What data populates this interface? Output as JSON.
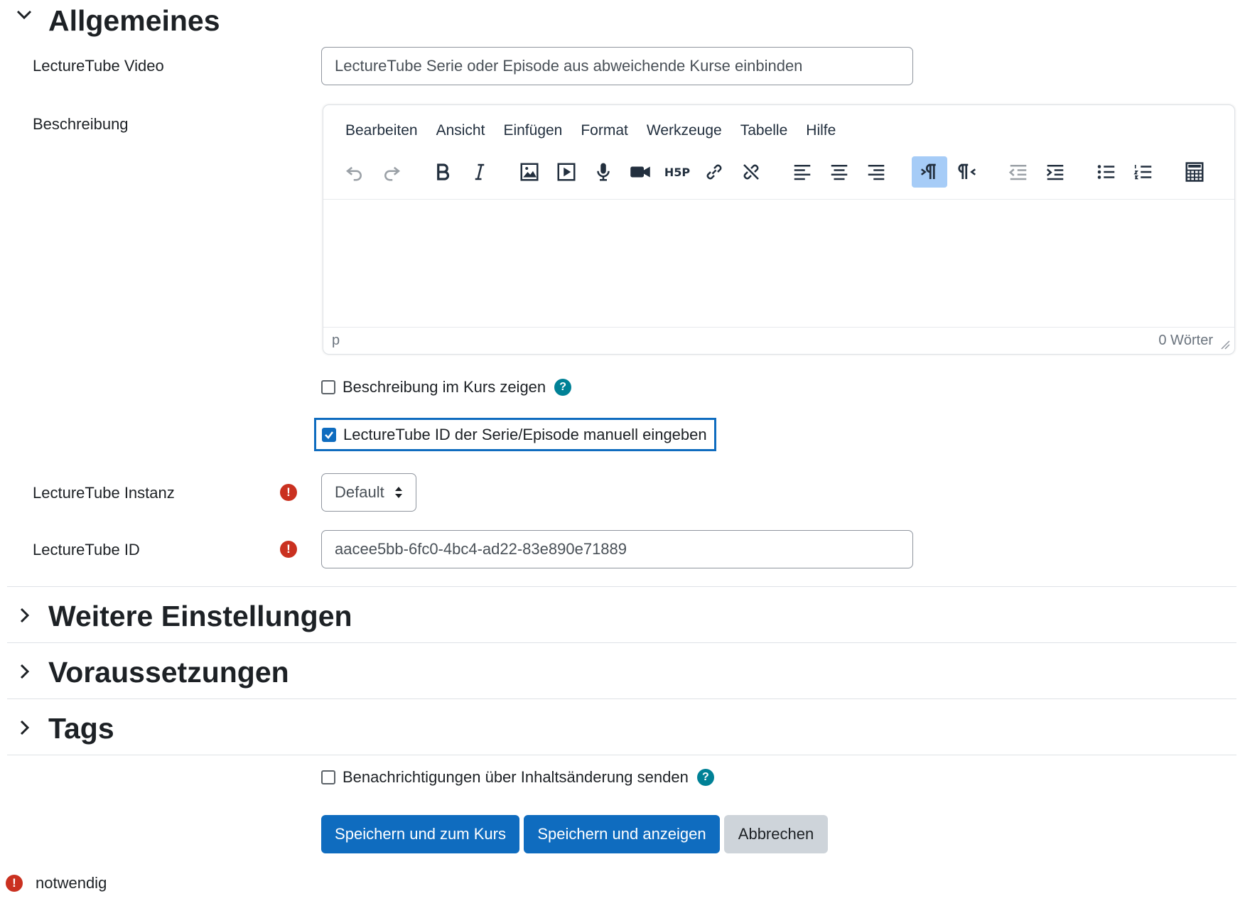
{
  "sections": {
    "general": "Allgemeines",
    "more_settings": "Weitere Einstellungen",
    "prerequisites": "Voraussetzungen",
    "tags": "Tags"
  },
  "fields": {
    "video_label": "LectureTube Video",
    "video_value": "LectureTube Serie oder Episode aus abweichende Kurse einbinden",
    "description_label": "Beschreibung",
    "instance_label": "LectureTube Instanz",
    "instance_value": "Default",
    "id_label": "LectureTube ID",
    "id_value": "aacee5bb-6fc0-4bc4-ad22-83e890e71889"
  },
  "editor": {
    "menu": [
      "Bearbeiten",
      "Ansicht",
      "Einfügen",
      "Format",
      "Werkzeuge",
      "Tabelle",
      "Hilfe"
    ],
    "status_path": "p",
    "word_count": "0 Wörter",
    "toolbar_icons": [
      "undo-icon",
      "redo-icon",
      "bold-icon",
      "italic-icon",
      "image-icon",
      "media-icon",
      "microphone-icon",
      "video-camera-icon",
      "h5p-icon",
      "link-icon",
      "unlink-icon",
      "align-left-icon",
      "align-center-icon",
      "align-right-icon",
      "ltr-icon",
      "rtl-icon",
      "outdent-icon",
      "indent-icon",
      "bullet-list-icon",
      "numbered-list-icon",
      "calculator-icon"
    ],
    "h5p_text": "H5P"
  },
  "checkboxes": {
    "show_description": "Beschreibung im Kurs zeigen",
    "show_description_checked": false,
    "manual_id": "LectureTube ID der Serie/Episode manuell eingeben",
    "manual_id_checked": true,
    "notify": "Benachrichtigungen über Inhaltsänderung senden",
    "notify_checked": false
  },
  "buttons": {
    "save_return": "Speichern und zum Kurs",
    "save_display": "Speichern und anzeigen",
    "cancel": "Abbrechen"
  },
  "footer": {
    "required_note": "notwendig"
  },
  "colors": {
    "primary": "#0f6cbf",
    "required": "#ca3120",
    "help": "#008196",
    "active_toolbar": "#a6ccf7"
  }
}
